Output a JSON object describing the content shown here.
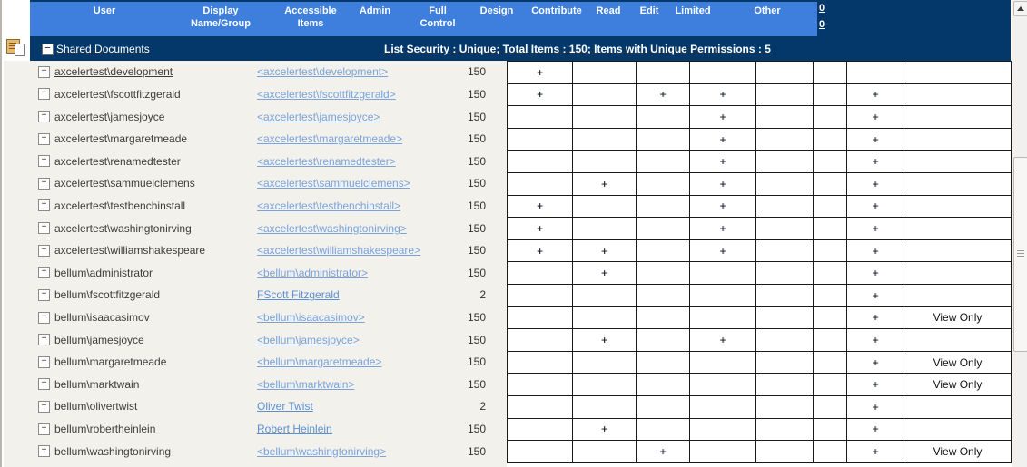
{
  "header": {
    "columns": [
      {
        "label": "User"
      },
      {
        "label": "Display Name/Group"
      },
      {
        "label": "Accessible Items"
      },
      {
        "label": "Admin"
      },
      {
        "label": "Full Control"
      },
      {
        "label": "Design"
      },
      {
        "label": "Contribute"
      },
      {
        "label": "Read"
      },
      {
        "label": "Edit"
      },
      {
        "label": "Limited"
      },
      {
        "label": "Other"
      }
    ],
    "frame_zeros": [
      "0",
      "0"
    ]
  },
  "section": {
    "title": "Shared Documents",
    "summary": "List Security : Unique; Total Items : 150; Items with Unique Permissions : 5"
  },
  "colors": {
    "header_blue": "#3E7EDC",
    "header_navy": "#04386B",
    "left_panel_bg": "#F2F1EB",
    "link_light_blue": "#7AA3DC",
    "link_named_blue": "#5B90D2"
  },
  "permission_column_keys": [
    "Admin",
    "Full Control",
    "Design",
    "Contribute",
    "Read",
    "Edit",
    "Limited",
    "Other"
  ],
  "rows": [
    {
      "user": "axcelertest\\development",
      "user_is_link": true,
      "display": "<axcelertest\\development>",
      "items": "150",
      "cells": [
        "+",
        "",
        "",
        "",
        "",
        "",
        "",
        ""
      ]
    },
    {
      "user": "axcelertest\\fscottfitzgerald",
      "user_is_link": false,
      "display": "<axcelertest\\fscottfitzgerald>",
      "items": "150",
      "cells": [
        "+",
        "",
        "+",
        "+",
        "",
        "",
        "+",
        ""
      ]
    },
    {
      "user": "axcelertest\\jamesjoyce",
      "user_is_link": false,
      "display": "<axcelertest\\jamesjoyce>",
      "items": "150",
      "cells": [
        "",
        "",
        "",
        "+",
        "",
        "",
        "+",
        ""
      ]
    },
    {
      "user": "axcelertest\\margaretmeade",
      "user_is_link": false,
      "display": "<axcelertest\\margaretmeade>",
      "items": "150",
      "cells": [
        "",
        "",
        "",
        "+",
        "",
        "",
        "+",
        ""
      ]
    },
    {
      "user": "axcelertest\\renamedtester",
      "user_is_link": false,
      "display": "<axcelertest\\renamedtester>",
      "items": "150",
      "cells": [
        "",
        "",
        "",
        "+",
        "",
        "",
        "+",
        ""
      ]
    },
    {
      "user": "axcelertest\\sammuelclemens",
      "user_is_link": false,
      "display": "<axcelertest\\sammuelclemens>",
      "items": "150",
      "cells": [
        "",
        "+",
        "",
        "+",
        "",
        "",
        "+",
        ""
      ]
    },
    {
      "user": "axcelertest\\testbenchinstall",
      "user_is_link": false,
      "display": "<axcelertest\\testbenchinstall>",
      "items": "150",
      "cells": [
        "+",
        "",
        "",
        "+",
        "",
        "",
        "+",
        ""
      ]
    },
    {
      "user": "axcelertest\\washingtonirving",
      "user_is_link": false,
      "display": "<axcelertest\\washingtonirving>",
      "items": "150",
      "cells": [
        "+",
        "",
        "",
        "+",
        "",
        "",
        "+",
        ""
      ]
    },
    {
      "user": "axcelertest\\williamshakespeare",
      "user_is_link": false,
      "display": "<axcelertest\\williamshakespeare>",
      "items": "150",
      "cells": [
        "+",
        "+",
        "",
        "+",
        "",
        "",
        "+",
        ""
      ]
    },
    {
      "user": "bellum\\administrator",
      "user_is_link": false,
      "display": "<bellum\\administrator>",
      "items": "150",
      "cells": [
        "",
        "+",
        "",
        "",
        "",
        "",
        "+",
        ""
      ]
    },
    {
      "user": "bellum\\fscottfitzgerald",
      "user_is_link": false,
      "display": "FScott Fitzgerald",
      "items": "2",
      "cells": [
        "",
        "",
        "",
        "",
        "",
        "",
        "+",
        ""
      ]
    },
    {
      "user": "bellum\\isaacasimov",
      "user_is_link": false,
      "display": "<bellum\\isaacasimov>",
      "items": "150",
      "cells": [
        "",
        "",
        "",
        "",
        "",
        "",
        "+",
        "View Only"
      ]
    },
    {
      "user": "bellum\\jamesjoyce",
      "user_is_link": false,
      "display": "<bellum\\jamesjoyce>",
      "items": "150",
      "cells": [
        "",
        "+",
        "",
        "+",
        "",
        "",
        "+",
        ""
      ]
    },
    {
      "user": "bellum\\margaretmeade",
      "user_is_link": false,
      "display": "<bellum\\margaretmeade>",
      "items": "150",
      "cells": [
        "",
        "",
        "",
        "",
        "",
        "",
        "+",
        "View Only"
      ]
    },
    {
      "user": "bellum\\marktwain",
      "user_is_link": false,
      "display": "<bellum\\marktwain>",
      "items": "150",
      "cells": [
        "",
        "",
        "",
        "",
        "",
        "",
        "+",
        "View Only"
      ]
    },
    {
      "user": "bellum\\olivertwist",
      "user_is_link": false,
      "display": "Oliver Twist",
      "items": "2",
      "cells": [
        "",
        "",
        "",
        "",
        "",
        "",
        "+",
        ""
      ]
    },
    {
      "user": "bellum\\robertheinlein",
      "user_is_link": false,
      "display": "Robert Heinlein",
      "items": "150",
      "cells": [
        "",
        "+",
        "",
        "",
        "",
        "",
        "+",
        ""
      ]
    },
    {
      "user": "bellum\\washingtonirving",
      "user_is_link": false,
      "display": "<bellum\\washingtonirving>",
      "items": "150",
      "cells": [
        "",
        "",
        "+",
        "",
        "",
        "",
        "+",
        "View Only"
      ]
    }
  ]
}
